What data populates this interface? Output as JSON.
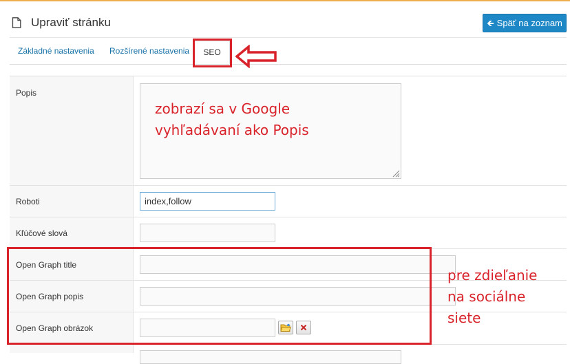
{
  "header": {
    "title": "Upraviť stránku",
    "page_icon": "document-icon",
    "back_button": {
      "label": "Späť na zoznam",
      "icon": "arrow-left-icon"
    }
  },
  "tabs": [
    {
      "label": "Základné nastavenia",
      "active": false
    },
    {
      "label": "Rozšírené nastavenia",
      "active": false
    },
    {
      "label": "SEO",
      "active": true
    }
  ],
  "form": {
    "popis": {
      "label": "Popis",
      "value": ""
    },
    "roboti": {
      "label": "Roboti",
      "value": "index,follow"
    },
    "klucove_slova": {
      "label": "Kľúčové slová",
      "value": ""
    },
    "og_title": {
      "label": "Open Graph title",
      "value": ""
    },
    "og_popis": {
      "label": "Open Graph popis",
      "value": ""
    },
    "og_obrazok": {
      "label": "Open Graph obrázok",
      "value": "",
      "browse_icon": "folder-icon",
      "clear_icon": "close-icon"
    }
  },
  "annotations": {
    "popis_note_line1": "zobrazí sa v Google",
    "popis_note_line2": "vyhľadávaní ako Popis",
    "og_note_line1": "pre zdieľanie",
    "og_note_line2": "na sociálne",
    "og_note_line3": "siete"
  },
  "colors": {
    "accent": "#f0ad4e",
    "primary_button": "#1e88c7",
    "tab_link": "#1a73a8",
    "annotation_red": "#d9232b"
  }
}
